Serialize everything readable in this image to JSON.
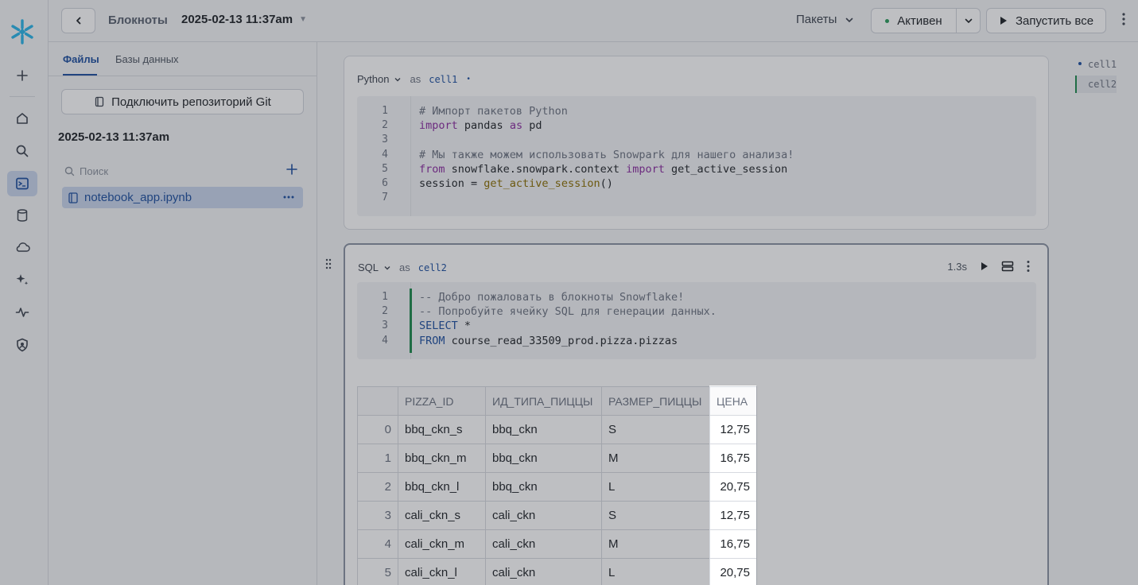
{
  "topbar": {
    "breadcrumb": "Блокноты",
    "notebook_title": "2025-02-13 11:37am",
    "packages_label": "Пакеты",
    "status_label": "Активен",
    "run_all_label": "Запустить все"
  },
  "filepanel": {
    "tabs": [
      "Файлы",
      "Базы данных"
    ],
    "git_button": "Подключить репозиторий Git",
    "folder_title": "2025-02-13 11:37am",
    "search_placeholder": "Поиск",
    "file_name": "notebook_app.ipynb"
  },
  "cell1": {
    "language": "Python",
    "as": "as",
    "name": "cell1",
    "line_numbers": [
      "1",
      "2",
      "3",
      "4",
      "5",
      "6",
      "7"
    ]
  },
  "cell2": {
    "language": "SQL",
    "as": "as",
    "name": "cell2",
    "duration": "1.3s",
    "line_numbers": [
      "1",
      "2",
      "3",
      "4"
    ]
  },
  "table": {
    "headers": [
      "PIZZA_ID",
      "ИД_ТИПА_ПИЦЦЫ",
      "РАЗМЕР_ПИЦЦЫ",
      "ЦЕНА"
    ],
    "rows": [
      {
        "idx": "0",
        "id": "bbq_ckn_s",
        "type": "bbq_ckn",
        "size": "S",
        "price": "12,75"
      },
      {
        "idx": "1",
        "id": "bbq_ckn_m",
        "type": "bbq_ckn",
        "size": "M",
        "price": "16,75"
      },
      {
        "idx": "2",
        "id": "bbq_ckn_l",
        "type": "bbq_ckn",
        "size": "L",
        "price": "20,75"
      },
      {
        "idx": "3",
        "id": "cali_ckn_s",
        "type": "cali_ckn",
        "size": "S",
        "price": "12,75"
      },
      {
        "idx": "4",
        "id": "cali_ckn_m",
        "type": "cali_ckn",
        "size": "M",
        "price": "16,75"
      },
      {
        "idx": "5",
        "id": "cali_ckn_l",
        "type": "cali_ckn",
        "size": "L",
        "price": "20,75"
      }
    ]
  },
  "outline": [
    "cell1",
    "cell2"
  ],
  "colors": {
    "accent": "#1d4fa0",
    "active_green": "#1e8a4c",
    "snowflake": "#29b5e8"
  }
}
